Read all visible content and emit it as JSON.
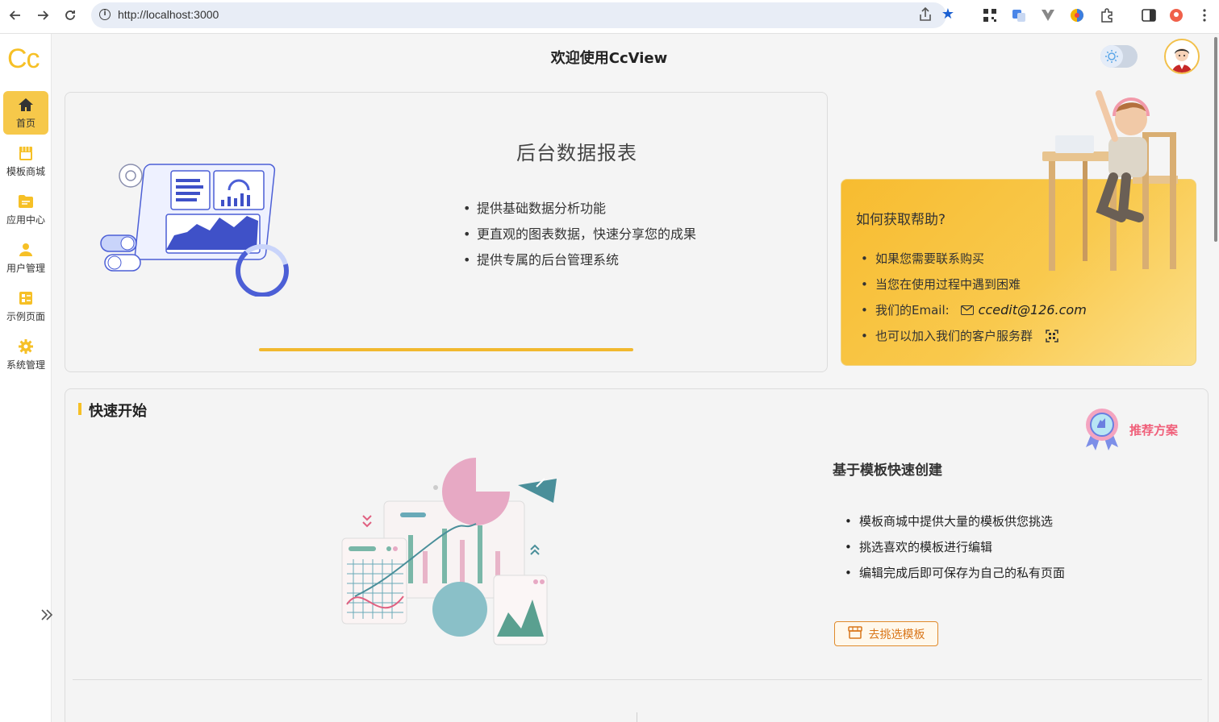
{
  "browser": {
    "url": "http://localhost:3000"
  },
  "sidebar": {
    "logo": "Cc",
    "items": [
      {
        "label": "首页",
        "icon": "home-icon",
        "active": true
      },
      {
        "label": "模板商城",
        "icon": "store-icon"
      },
      {
        "label": "应用中心",
        "icon": "folder-icon"
      },
      {
        "label": "用户管理",
        "icon": "user-icon"
      },
      {
        "label": "示例页面",
        "icon": "list-icon"
      },
      {
        "label": "系统管理",
        "icon": "gear-icon"
      }
    ],
    "collapse_icon": "double-chevron-right-icon"
  },
  "header": {
    "title": "欢迎使用CcView"
  },
  "report": {
    "title": "后台数据报表",
    "items": [
      "提供基础数据分析功能",
      "更直观的图表数据，快速分享您的成果",
      "提供专属的后台管理系统"
    ]
  },
  "help": {
    "title": "如何获取帮助?",
    "items": [
      "如果您需要联系购买",
      "当您在使用过程中遇到困难",
      "我们的Email:",
      "也可以加入我们的客户服务群"
    ],
    "email": "ccedit@126.com"
  },
  "quick": {
    "title": "快速开始",
    "recommend": "推荐方案",
    "heading": "基于模板快速创建",
    "items": [
      "模板商城中提供大量的模板供您挑选",
      "挑选喜欢的模板进行编辑",
      "编辑完成后即可保存为自己的私有页面"
    ],
    "button": "去挑选模板"
  },
  "colors": {
    "accent": "#f6c026",
    "help_bg": "#f7bc30",
    "recommend": "#f0607a",
    "button": "#d9761a"
  }
}
